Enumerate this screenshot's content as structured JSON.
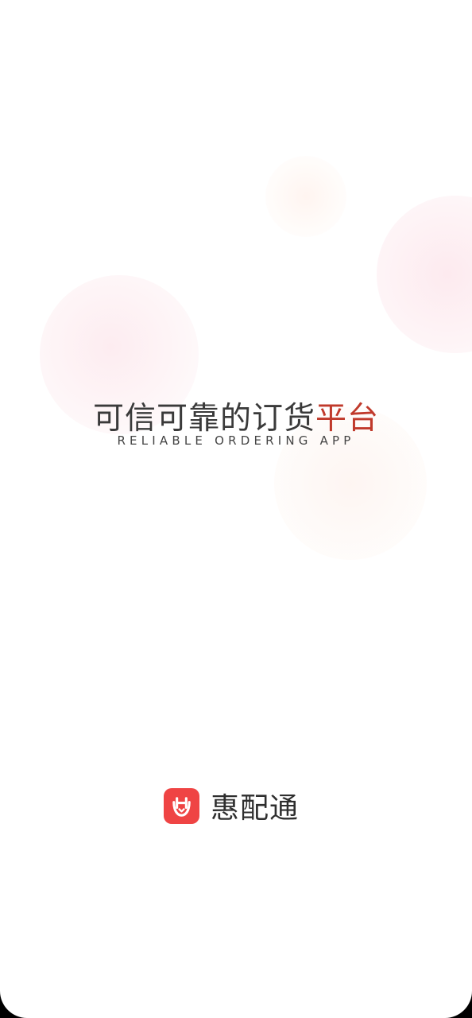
{
  "splash": {
    "slogan_main": "可信可靠的订货",
    "slogan_accent": "平台",
    "subtitle": "RELIABLE ORDERING APP"
  },
  "brand": {
    "name": "惠配通",
    "logo_icon": "hui-pei-tong-logo-icon"
  },
  "colors": {
    "accent": "#c0392b",
    "logo_background": "#ef4444",
    "text": "#3a3a3a"
  }
}
